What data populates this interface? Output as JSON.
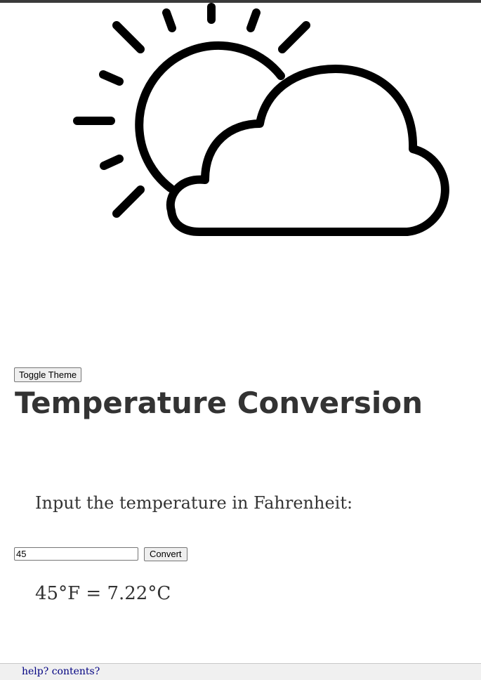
{
  "colors": {
    "text": "#333333",
    "link": "#000080",
    "icon_stroke": "#000000",
    "top_bar": "#3a3a3a"
  },
  "hero": {
    "icon": "partly-cloudy-icon"
  },
  "toolbar": {
    "toggle_theme_label": "Toggle Theme"
  },
  "page": {
    "title": "Temperature Conversion",
    "prompt": "Input the temperature in Fahrenheit:"
  },
  "form": {
    "input_value": "45",
    "convert_label": "Convert"
  },
  "result": {
    "text": "45°F = 7.22°C"
  },
  "footer": {
    "help_link": "help? contents?"
  }
}
